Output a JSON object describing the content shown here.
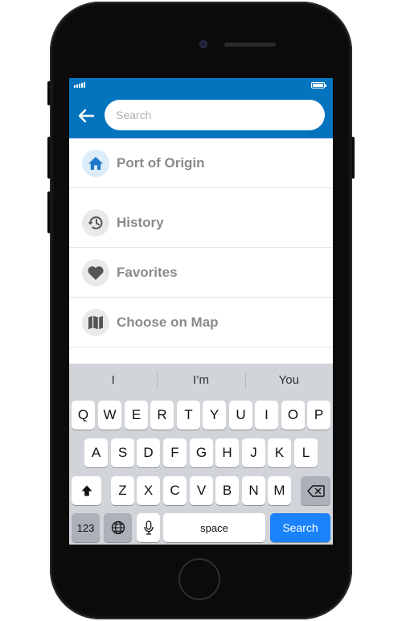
{
  "search": {
    "placeholder": "Search",
    "value": ""
  },
  "menu": {
    "items": [
      {
        "label": "Port of Origin",
        "icon": "home-icon"
      },
      {
        "label": "History",
        "icon": "history-icon"
      },
      {
        "label": "Favorites",
        "icon": "heart-icon"
      },
      {
        "label": "Choose on Map",
        "icon": "map-icon"
      }
    ]
  },
  "keyboard": {
    "predictions": [
      "I",
      "I’m",
      "You"
    ],
    "row1": [
      "Q",
      "W",
      "E",
      "R",
      "T",
      "Y",
      "U",
      "I",
      "O",
      "P"
    ],
    "row2": [
      "A",
      "S",
      "D",
      "F",
      "G",
      "H",
      "J",
      "K",
      "L"
    ],
    "row3": [
      "Z",
      "X",
      "C",
      "V",
      "B",
      "N",
      "M"
    ],
    "numbers_label": "123",
    "space_label": "space",
    "search_label": "Search"
  },
  "colors": {
    "header": "#0474bf",
    "accent": "#1a82fb",
    "icon_blue": "#1f78c8",
    "icon_gray": "#555555"
  }
}
